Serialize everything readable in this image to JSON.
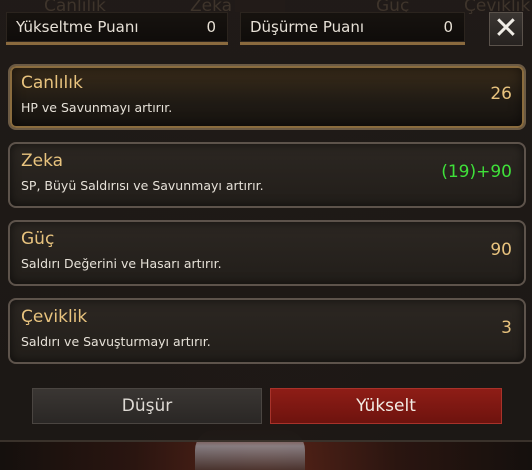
{
  "background": {
    "labels": [
      "Canlılık",
      "Zeka",
      "Güç",
      "Çeviklik"
    ]
  },
  "header": {
    "upgrade_points": {
      "label": "Yükseltme Puanı",
      "value": "0"
    },
    "downgrade_points": {
      "label": "Düşürme Puanı",
      "value": "0"
    },
    "close_symbol": "✕"
  },
  "stats": [
    {
      "name": "Canlılık",
      "description": "HP ve Savunmayı artırır.",
      "bonus": "",
      "value": "26",
      "selected": true
    },
    {
      "name": "Zeka",
      "description": "SP, Büyü Saldırısı ve Savunmayı artırır.",
      "bonus": "(19)+90",
      "value": "",
      "selected": false
    },
    {
      "name": "Güç",
      "description": "Saldırı Değerini ve Hasarı artırır.",
      "bonus": "",
      "value": "90",
      "selected": false
    },
    {
      "name": "Çeviklik",
      "description": "Saldırı ve Savuşturmayı artırır.",
      "bonus": "",
      "value": "3",
      "selected": false
    }
  ],
  "buttons": {
    "decrease_label": "Düşür",
    "increase_label": "Yükselt"
  },
  "colors": {
    "stat_name": "#e8c37e",
    "bonus_green": "#3fe03a",
    "increase_button": "#8e1d16"
  }
}
